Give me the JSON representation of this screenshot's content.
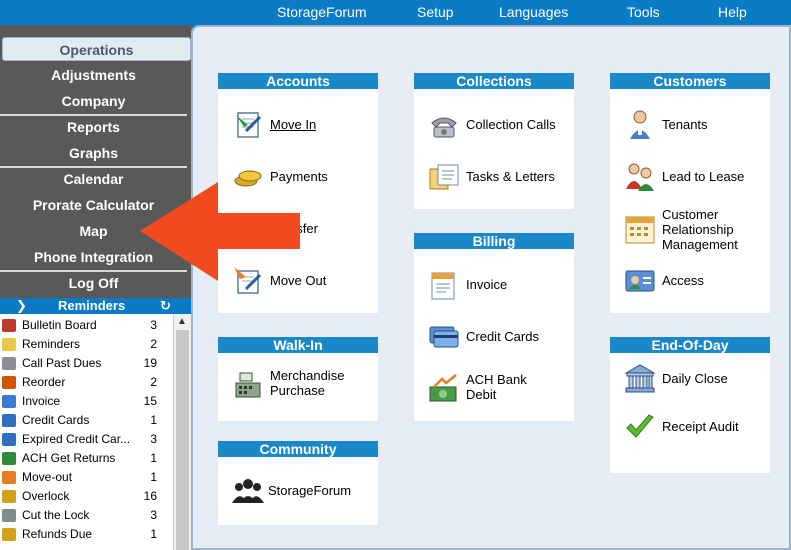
{
  "top_menu": {
    "items": [
      "StorageForum",
      "Setup",
      "Languages",
      "Tools",
      "Help"
    ]
  },
  "sidebar": {
    "items": [
      {
        "label": "Operations",
        "active": true
      },
      {
        "label": "Adjustments"
      },
      {
        "label": "Company"
      },
      {
        "label": "Reports"
      },
      {
        "label": "Graphs"
      },
      {
        "label": "Calendar"
      },
      {
        "label": "Prorate Calculator"
      },
      {
        "label": "Map"
      },
      {
        "label": "Phone Integration"
      },
      {
        "label": "Log Off"
      }
    ]
  },
  "reminders": {
    "title": "Reminders",
    "rows": [
      {
        "label": "Bulletin Board",
        "count": "3",
        "icon": "clipboard-icon",
        "color": "#c0392b"
      },
      {
        "label": "Reminders",
        "count": "2",
        "icon": "note-icon",
        "color": "#e8c84a"
      },
      {
        "label": "Call Past Dues",
        "count": "19",
        "icon": "phone-icon",
        "color": "#8a8f99"
      },
      {
        "label": "Reorder",
        "count": "2",
        "icon": "basket-icon",
        "color": "#d35400"
      },
      {
        "label": "Invoice",
        "count": "15",
        "icon": "invoice-icon",
        "color": "#3a7bd5"
      },
      {
        "label": "Credit Cards",
        "count": "1",
        "icon": "credit-card-icon",
        "color": "#2e6fc2"
      },
      {
        "label": "Expired Credit Car...",
        "count": "3",
        "icon": "credit-card-icon",
        "color": "#2e6fc2"
      },
      {
        "label": "ACH Get Returns",
        "count": "1",
        "icon": "ach-icon",
        "color": "#2e8b3a"
      },
      {
        "label": "Move-out",
        "count": "1",
        "icon": "move-out-icon",
        "color": "#e67e22"
      },
      {
        "label": "Overlock",
        "count": "16",
        "icon": "lock-icon",
        "color": "#d4a017"
      },
      {
        "label": "Cut the Lock",
        "count": "3",
        "icon": "scissors-icon",
        "color": "#7f8c8d"
      },
      {
        "label": "Refunds Due",
        "count": "1",
        "icon": "coins-icon",
        "color": "#d4a017"
      }
    ]
  },
  "panels": {
    "accounts": {
      "title": "Accounts",
      "items": [
        {
          "label": "Move In",
          "icon": "move-in-icon"
        },
        {
          "label": "Payments",
          "icon": "coins-icon"
        },
        {
          "label": "Transfer",
          "icon": "transfer-icon"
        },
        {
          "label": "Move Out",
          "icon": "move-out-icon"
        }
      ]
    },
    "walkin": {
      "title": "Walk-In",
      "items": [
        {
          "label_line1": "Merchandise",
          "label_line2": "Purchase",
          "icon": "cash-register-icon"
        }
      ]
    },
    "community": {
      "title": "Community",
      "items": [
        {
          "label": "StorageForum",
          "icon": "people-icon"
        }
      ]
    },
    "collections": {
      "title": "Collections",
      "items": [
        {
          "label": "Collection Calls",
          "icon": "telephone-icon"
        },
        {
          "label": "Tasks & Letters",
          "icon": "letters-icon"
        }
      ]
    },
    "billing": {
      "title": "Billing",
      "items": [
        {
          "label": "Invoice",
          "icon": "invoice-icon"
        },
        {
          "label": "Credit Cards",
          "icon": "credit-card-icon"
        },
        {
          "label_line1": "ACH Bank",
          "label_line2": "Debit",
          "icon": "ach-icon"
        }
      ]
    },
    "customers": {
      "title": "Customers",
      "items": [
        {
          "label": "Tenants",
          "icon": "tenant-icon"
        },
        {
          "label": "Lead to Lease",
          "icon": "lead-icon"
        },
        {
          "label_line1": "Customer",
          "label_line2": "Relationship",
          "label_line3": "Management",
          "icon": "calendar-icon"
        },
        {
          "label": "Access",
          "icon": "access-icon"
        }
      ]
    },
    "endofday": {
      "title": "End-Of-Day",
      "items": [
        {
          "label": "Daily Close",
          "icon": "bank-icon"
        },
        {
          "label": "Receipt Audit",
          "icon": "checkmark-icon"
        }
      ]
    }
  },
  "colors": {
    "brand_blue": "#0a7bc4",
    "panel_header": "#1a87c9",
    "sidebar": "#595959",
    "arrow": "#f04a1e"
  }
}
